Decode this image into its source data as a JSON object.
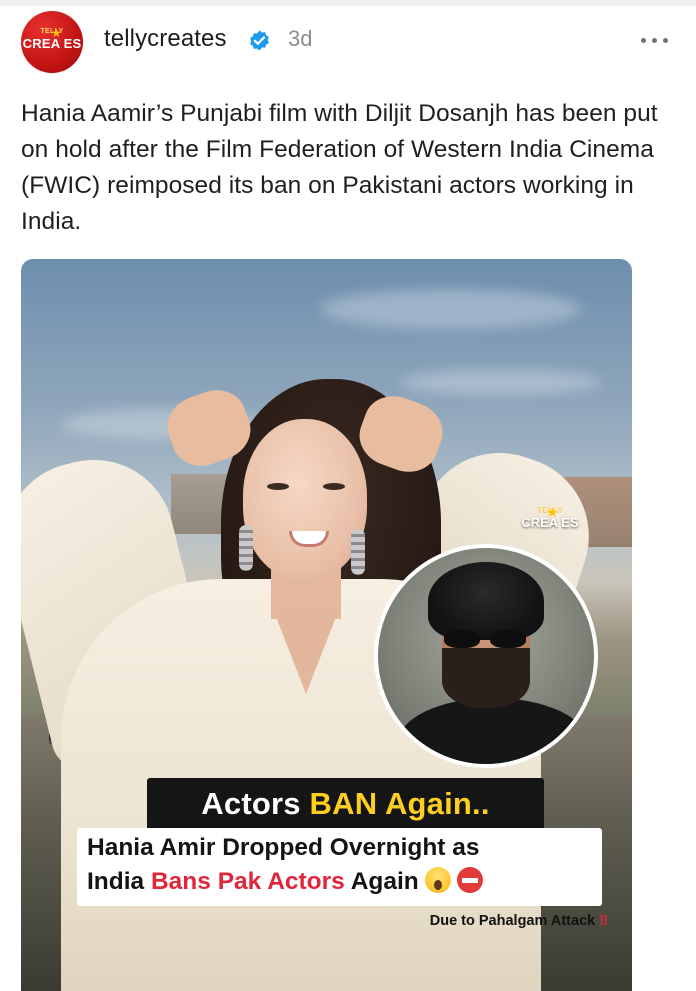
{
  "post": {
    "username": "tellycreates",
    "time": "3d",
    "avatar": {
      "logo_top": "TELLY",
      "logo_main": "CREA  ES"
    },
    "caption": "Hania Aamir’s Punjabi film with Diljit Dosanjh has been put on hold after the Film Federation of Western India Cinema (FWIC) reimposed its ban on Pakistani actors working in India.",
    "icons": {
      "verified": "verified-badge-icon",
      "more": "more-options-icon"
    }
  },
  "media": {
    "watermark": {
      "top": "TELLY",
      "main": "CREA  ES"
    },
    "headline_part1": "Actors ",
    "headline_part2": "BAN Again..",
    "subhead_line1": "Hania Amir Dropped Overnight as",
    "subhead_line2_a": "India ",
    "subhead_line2_b": "Bans Pak Actors",
    "subhead_line2_c": " Again",
    "footer_text": "Due to Pahalgam Attack ",
    "footer_mark": "‼",
    "colors": {
      "headline_highlight": "#ffcf1f",
      "subhead_highlight": "#e0263a"
    }
  }
}
